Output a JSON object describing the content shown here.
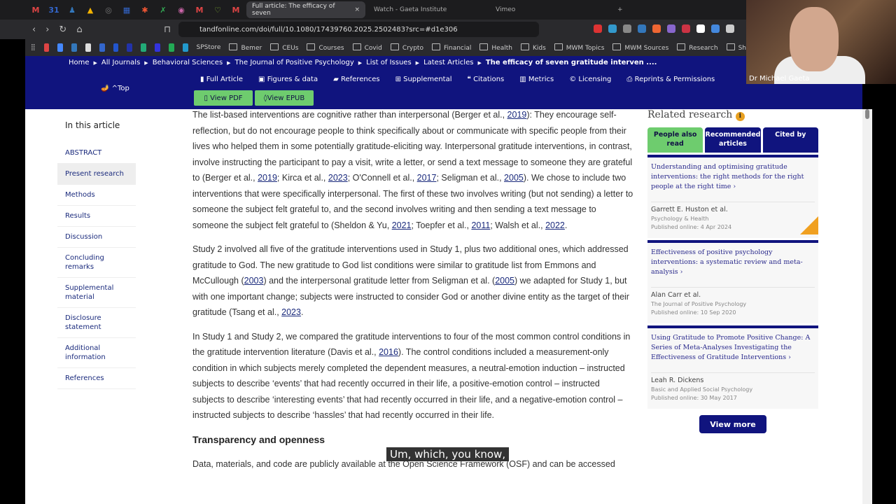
{
  "browser": {
    "pinned": [
      "M",
      "31",
      "♟",
      "▲",
      "◎",
      "▦",
      "✱",
      "✗",
      "◉",
      "M",
      "♡",
      "M"
    ],
    "tabs": [
      {
        "label": "Full article: The efficacy of seven",
        "active": true
      },
      {
        "label": "Watch - Gaeta Institute"
      },
      {
        "label": "Vimeo"
      }
    ],
    "url": "tandfonline.com/doi/full/10.1080/17439760.2025.2502483?src=#d1e306",
    "bookmarks": [
      "SPStore",
      "Bemer",
      "CEUs",
      "Courses",
      "Covid",
      "Crypto",
      "Financial",
      "Health",
      "Kids",
      "MWM Topics",
      "MWM Sources",
      "Research",
      "Sh"
    ]
  },
  "nav": {
    "breadcrumbs": [
      "Home",
      "All Journals",
      "Behavioral Sciences",
      "The Journal of Positive Psychology",
      "List of Issues",
      "Latest Articles",
      "The efficacy of seven gratitude interven ...."
    ],
    "top": "^Top",
    "tabs": [
      "Full Article",
      "Figures & data",
      "References",
      "Supplemental",
      "Citations",
      "Metrics",
      "Licensing",
      "Reprints & Permissions"
    ],
    "view_pdf": "View PDF",
    "view_epub": "View EPUB"
  },
  "toc": {
    "title": "In this article",
    "items": [
      "ABSTRACT",
      "Present research",
      "Methods",
      "Results",
      "Discussion",
      "Concluding remarks",
      "Supplemental material",
      "Disclosure statement",
      "Additional information",
      "References"
    ]
  },
  "article": {
    "p1": [
      "The list-based interventions are cognitive rather than interpersonal (Berger et al., ",
      "2019",
      "): They encourage self-reflection, but do not encourage people to think specifically about or communicate with specific people from their lives who helped them in some potentially gratitude-eliciting way. Interpersonal gratitude interventions, in contrast, involve instructing the participant to pay a visit, write a letter, or send a text message to someone they are grateful to (Berger et al., ",
      "2019",
      "; Kirca et al., ",
      "2023",
      "; O'Connell et al., ",
      "2017",
      "; Seligman et al., ",
      "2005",
      "). We chose to include two interventions that were specifically interpersonal. The first of these two involves writing (but not sending) a letter to someone the subject felt grateful to, and the second involves writing and then sending a text message to someone the subject felt grateful to (Sheldon & Yu, ",
      "2021",
      "; Toepfer et al., ",
      "2011",
      "; Walsh et al., ",
      "2022",
      "."
    ],
    "p2": [
      "Study 2 involved all five of the gratitude interventions used in Study 1, plus two additional ones, which addressed gratitude to God. The new gratitude to God list conditions were similar to gratitude list from Emmons and McCullough (",
      "2003",
      ") and the interpersonal gratitude letter from Seligman et al. (",
      "2005",
      ") we adapted for Study 1, but with one important change; subjects were instructed to consider God or another divine entity as the target of their gratitude (Tsang et al., ",
      "2023",
      "."
    ],
    "p3": [
      "In Study 1 and Study 2, we compared the gratitude interventions to four of the most common control conditions in the gratitude intervention literature (Davis et al., ",
      "2016",
      "). The control conditions included a measurement-only condition in which subjects merely completed the dependent measures, a neutral-emotion induction – instructed subjects to describe ‘events’ that had recently occurred in their life, a positive-emotion control – instructed subjects to describe ‘interesting events’ that had recently occurred in their life, and a negative-emotion control – instructed subjects to describe ‘hassles’ that had recently occurred in their life."
    ],
    "heading": "Transparency and openness",
    "p4": "Data, materials, and code are publicly available at the Open Science Framework (OSF) and can be accessed"
  },
  "related": {
    "title": "Related research",
    "tabs": [
      "People also read",
      "Recommended articles",
      "Cited by"
    ],
    "cards": [
      {
        "title": "Understanding and optimising gratitude interventions: the right methods for the right people at the right time",
        "author": "Garrett E. Huston et al.",
        "journal": "Psychology & Health",
        "date": "Published online: 4 Apr 2024"
      },
      {
        "title": "Effectiveness of positive psychology interventions: a systematic review and meta-analysis",
        "author": "Alan Carr et al.",
        "journal": "The Journal of Positive Psychology",
        "date": "Published online: 10 Sep 2020"
      },
      {
        "title": "Using Gratitude to Promote Positive Change: A Series of Meta-Analyses Investigating the Effectiveness of Gratitude Interventions",
        "author": "Leah R. Dickens",
        "journal": "Basic and Applied Social Psychology",
        "date": "Published online: 30 May 2017"
      }
    ],
    "view_more": "View more"
  },
  "caption": "Um, which, you know,",
  "webcam": {
    "name": "Dr Michael Gaeta"
  }
}
